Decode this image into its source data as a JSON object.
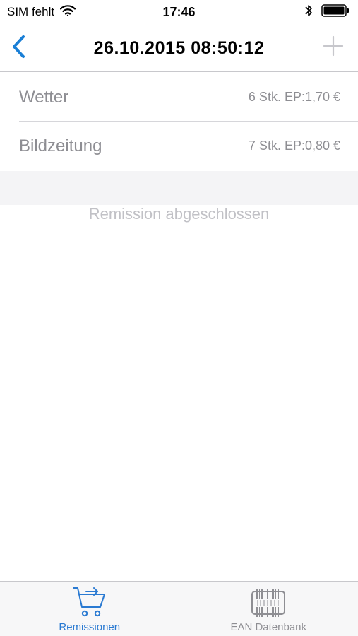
{
  "status_bar": {
    "carrier": "SIM fehlt",
    "time": "17:46",
    "wifi_icon": "wifi-icon",
    "bluetooth_icon": "bluetooth-icon",
    "battery_icon": "battery-icon"
  },
  "nav": {
    "title": "26.10.2015 08:50:12",
    "back_icon": "chevron-left-icon",
    "add_icon": "plus-icon",
    "accent_color": "#1a7fd6",
    "add_disabled_color": "#c7c7cc"
  },
  "items": [
    {
      "name": "Wetter",
      "detail": "6 Stk. EP:1,70 €"
    },
    {
      "name": "Bildzeitung",
      "detail": "7 Stk. EP:0,80 €"
    }
  ],
  "message": "Remission abgeschlossen",
  "tabs": [
    {
      "label": "Remissionen",
      "icon": "cart-return-icon",
      "active": true
    },
    {
      "label": "EAN Datenbank",
      "icon": "barcode-icon",
      "active": false
    }
  ]
}
